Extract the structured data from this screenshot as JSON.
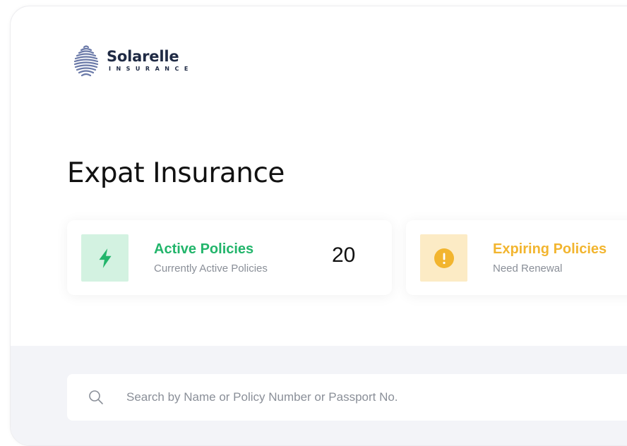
{
  "brand": {
    "name": "Solarelle",
    "tagline": "INSURANCE",
    "icon": "solarelle-logo-mark"
  },
  "page": {
    "title": "Expat Insurance"
  },
  "stats": {
    "active": {
      "title": "Active Policies",
      "subtitle": "Currently Active Policies",
      "count": "20",
      "icon": "lightning-icon",
      "color": "#22b56b",
      "tile_color": "#d3f2e1"
    },
    "expiring": {
      "title": "Expiring Policies",
      "subtitle": "Need Renewal",
      "icon": "alert-icon",
      "color": "#f2b52f",
      "tile_color": "#fcebc5"
    }
  },
  "search": {
    "placeholder": "Search by Name or Policy Number or Passport No.",
    "value": "",
    "icon": "search-icon"
  }
}
